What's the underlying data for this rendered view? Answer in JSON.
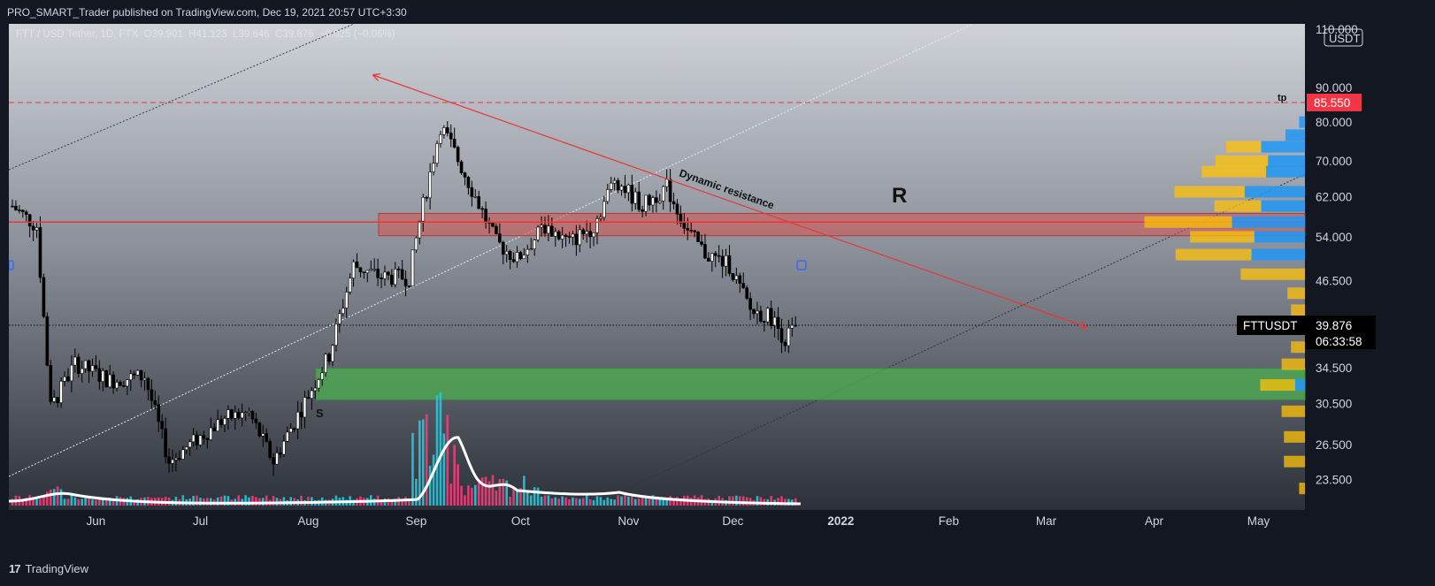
{
  "header": {
    "published_text": "PRO_SMART_Trader published on TradingView.com, Dec 19, 2021 20:57 UTC+3:30"
  },
  "legend": {
    "symbol_text": "FTT / USD Tether, 1D, FTX",
    "open_label": "O",
    "open_value": "39.901",
    "high_label": "H",
    "high_value": "41.123",
    "low_label": "L",
    "low_value": "39.646",
    "close_label": "C",
    "close_value": "39.876",
    "change_text": "−0.025 (−0.06%)"
  },
  "footer": {
    "brand": "TradingView",
    "logo_text": "17"
  },
  "colors": {
    "background_top": "#c9ccd4",
    "background_bottom": "#1e222d",
    "up_candle": "#ffffff",
    "down_candle": "#000000",
    "resistance_zone": "#d9534f",
    "support_zone": "#4caf50",
    "trend_line": "#e53935",
    "current_price_label": "#000000",
    "price_tag_red": "#f23645",
    "volume_up": "#26c6da",
    "volume_down": "#ec407a",
    "profile_blue": "#2196f3",
    "profile_yellow": "#ffc107"
  },
  "chart_data": {
    "type": "candlestick",
    "symbol": "FTTUSDT",
    "interval": "1D",
    "exchange": "FTX",
    "x_tick_labels": [
      "Jun",
      "Jul",
      "Aug",
      "Sep",
      "Oct",
      "Nov",
      "Dec",
      "2022",
      "Feb",
      "Mar",
      "Apr",
      "May"
    ],
    "y_tick_labels": [
      "23.500",
      "26.500",
      "30.500",
      "34.500",
      "46.500",
      "54.000",
      "62.000",
      "70.000",
      "80.000",
      "90.000",
      "110.000"
    ],
    "y_unit": "USDT",
    "scale": "log",
    "ylim": [
      21.5,
      112
    ],
    "last_price": "39.876",
    "countdown": "06:33:58",
    "last_label": "FTTUSDT",
    "high_marker": "85.550",
    "high_marker_value": 85.55,
    "approx_ohlc_path": [
      {
        "date": "2021-05-08",
        "close": 60.0
      },
      {
        "date": "2021-05-15",
        "close": 56.0
      },
      {
        "date": "2021-05-19",
        "close": 30.0
      },
      {
        "date": "2021-05-26",
        "close": 35.0
      },
      {
        "date": "2021-06-05",
        "close": 33.0
      },
      {
        "date": "2021-06-15",
        "close": 33.5
      },
      {
        "date": "2021-06-22",
        "close": 25.0
      },
      {
        "date": "2021-06-28",
        "close": 26.5
      },
      {
        "date": "2021-07-08",
        "close": 29.0
      },
      {
        "date": "2021-07-15",
        "close": 29.5
      },
      {
        "date": "2021-07-22",
        "close": 25.0
      },
      {
        "date": "2021-07-30",
        "close": 30.0
      },
      {
        "date": "2021-08-07",
        "close": 36.0
      },
      {
        "date": "2021-08-14",
        "close": 49.0
      },
      {
        "date": "2021-08-22",
        "close": 47.0
      },
      {
        "date": "2021-08-30",
        "close": 47.0
      },
      {
        "date": "2021-09-02",
        "close": 57.0
      },
      {
        "date": "2021-09-08",
        "close": 79.0
      },
      {
        "date": "2021-09-11",
        "close": 74.0
      },
      {
        "date": "2021-09-18",
        "close": 62.0
      },
      {
        "date": "2021-09-24",
        "close": 53.0
      },
      {
        "date": "2021-09-30",
        "close": 50.0
      },
      {
        "date": "2021-10-08",
        "close": 56.0
      },
      {
        "date": "2021-10-15",
        "close": 53.0
      },
      {
        "date": "2021-10-22",
        "close": 56.0
      },
      {
        "date": "2021-10-28",
        "close": 66.0
      },
      {
        "date": "2021-11-05",
        "close": 60.0
      },
      {
        "date": "2021-11-12",
        "close": 64.0
      },
      {
        "date": "2021-11-18",
        "close": 55.0
      },
      {
        "date": "2021-11-23",
        "close": 51.0
      },
      {
        "date": "2021-11-30",
        "close": 49.0
      },
      {
        "date": "2021-12-06",
        "close": 42.0
      },
      {
        "date": "2021-12-12",
        "close": 41.0
      },
      {
        "date": "2021-12-16",
        "close": 38.0
      },
      {
        "date": "2021-12-19",
        "close": 39.876
      }
    ],
    "zones": {
      "resistance": {
        "low": 54.2,
        "high": 58.5,
        "label": "R"
      },
      "support": {
        "low": 30.9,
        "high": 34.4,
        "label": "S"
      }
    },
    "horizontal_line": 56.8,
    "trend_label": "Dynamic resistance",
    "volume_profile": [
      {
        "price": 80.0,
        "blue": 0.06,
        "yellow": 0.0
      },
      {
        "price": 76.5,
        "blue": 0.2,
        "yellow": 0.0
      },
      {
        "price": 73.5,
        "blue": 0.45,
        "yellow": 0.3
      },
      {
        "price": 70.0,
        "blue": 0.38,
        "yellow": 0.45
      },
      {
        "price": 67.5,
        "blue": 0.4,
        "yellow": 0.55
      },
      {
        "price": 63.0,
        "blue": 0.62,
        "yellow": 0.6
      },
      {
        "price": 60.0,
        "blue": 0.45,
        "yellow": 0.4
      },
      {
        "price": 56.8,
        "blue": 0.75,
        "yellow": 0.75
      },
      {
        "price": 54.0,
        "blue": 0.52,
        "yellow": 0.55
      },
      {
        "price": 50.8,
        "blue": 0.55,
        "yellow": 0.65
      },
      {
        "price": 47.5,
        "blue": 0.0,
        "yellow": 0.55
      },
      {
        "price": 44.5,
        "blue": 0.0,
        "yellow": 0.15
      },
      {
        "price": 42.0,
        "blue": 0.0,
        "yellow": 0.12
      },
      {
        "price": 39.5,
        "blue": 0.0,
        "yellow": 0.12
      },
      {
        "price": 37.0,
        "blue": 0.0,
        "yellow": 0.12
      },
      {
        "price": 34.9,
        "blue": 0.0,
        "yellow": 0.2
      },
      {
        "price": 32.5,
        "blue": 0.1,
        "yellow": 0.3
      },
      {
        "price": 29.7,
        "blue": 0.0,
        "yellow": 0.2
      },
      {
        "price": 27.2,
        "blue": 0.0,
        "yellow": 0.18
      },
      {
        "price": 25.0,
        "blue": 0.0,
        "yellow": 0.18
      },
      {
        "price": 22.8,
        "blue": 0.0,
        "yellow": 0.05
      }
    ]
  }
}
